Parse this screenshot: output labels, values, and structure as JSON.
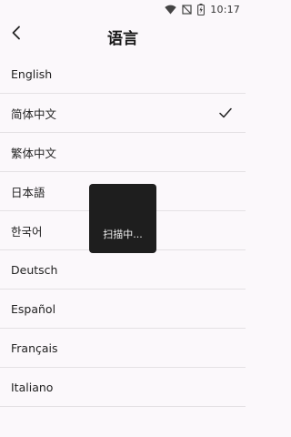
{
  "status_bar": {
    "time": "10:17",
    "icons": [
      "wifi-icon",
      "no-signal-icon",
      "battery-charging-icon"
    ]
  },
  "app_bar": {
    "title": "语言",
    "back_icon": "chevron-left-icon"
  },
  "languages": [
    {
      "label": "English",
      "selected": false
    },
    {
      "label": "简体中文",
      "selected": true
    },
    {
      "label": "繁体中文",
      "selected": false
    },
    {
      "label": "日本語",
      "selected": false
    },
    {
      "label": "한국어",
      "selected": false
    },
    {
      "label": "Deutsch",
      "selected": false
    },
    {
      "label": "Español",
      "selected": false
    },
    {
      "label": "Français",
      "selected": false
    },
    {
      "label": "Italiano",
      "selected": false
    }
  ],
  "toast": {
    "text": "扫描中..."
  },
  "colors": {
    "background": "#FBF8FB",
    "divider": "#E4E1E4",
    "toast_bg": "#1E1E1E",
    "text": "#222222"
  }
}
